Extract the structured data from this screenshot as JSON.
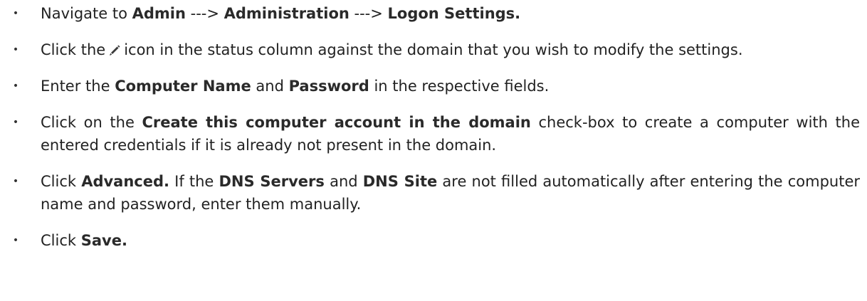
{
  "steps": [
    {
      "bullet": "•",
      "prefix": "Navigate to ",
      "b1": "Admin",
      "sep1": " ---> ",
      "b2": "Administration",
      "sep2": " ---> ",
      "b3": "Logon Settings."
    },
    {
      "bullet": "•",
      "before_icon": "Click the",
      "icon": "pencil-edit-icon",
      "after_icon": "icon in the status column against the domain that you wish to modify the settings."
    },
    {
      "bullet": "•",
      "prefix": "Enter the ",
      "b1": "Computer Name",
      "mid": " and ",
      "b2": "Password",
      "suffix": " in the respective fields."
    },
    {
      "bullet": "•",
      "prefix": "Click on the ",
      "b1": "Create this computer account in the domain",
      "suffix": " check-box to create a computer with the entered credentials if it is already not present in the domain."
    },
    {
      "bullet": "•",
      "prefix": "Click ",
      "b1": "Advanced.",
      "mid1": " If the ",
      "b2": "DNS Servers",
      "mid2": " and ",
      "b3": "DNS Site",
      "suffix": " are not filled automatically after entering the computer name and password, enter them manually."
    },
    {
      "bullet": "•",
      "prefix": "Click ",
      "b1": "Save."
    }
  ]
}
